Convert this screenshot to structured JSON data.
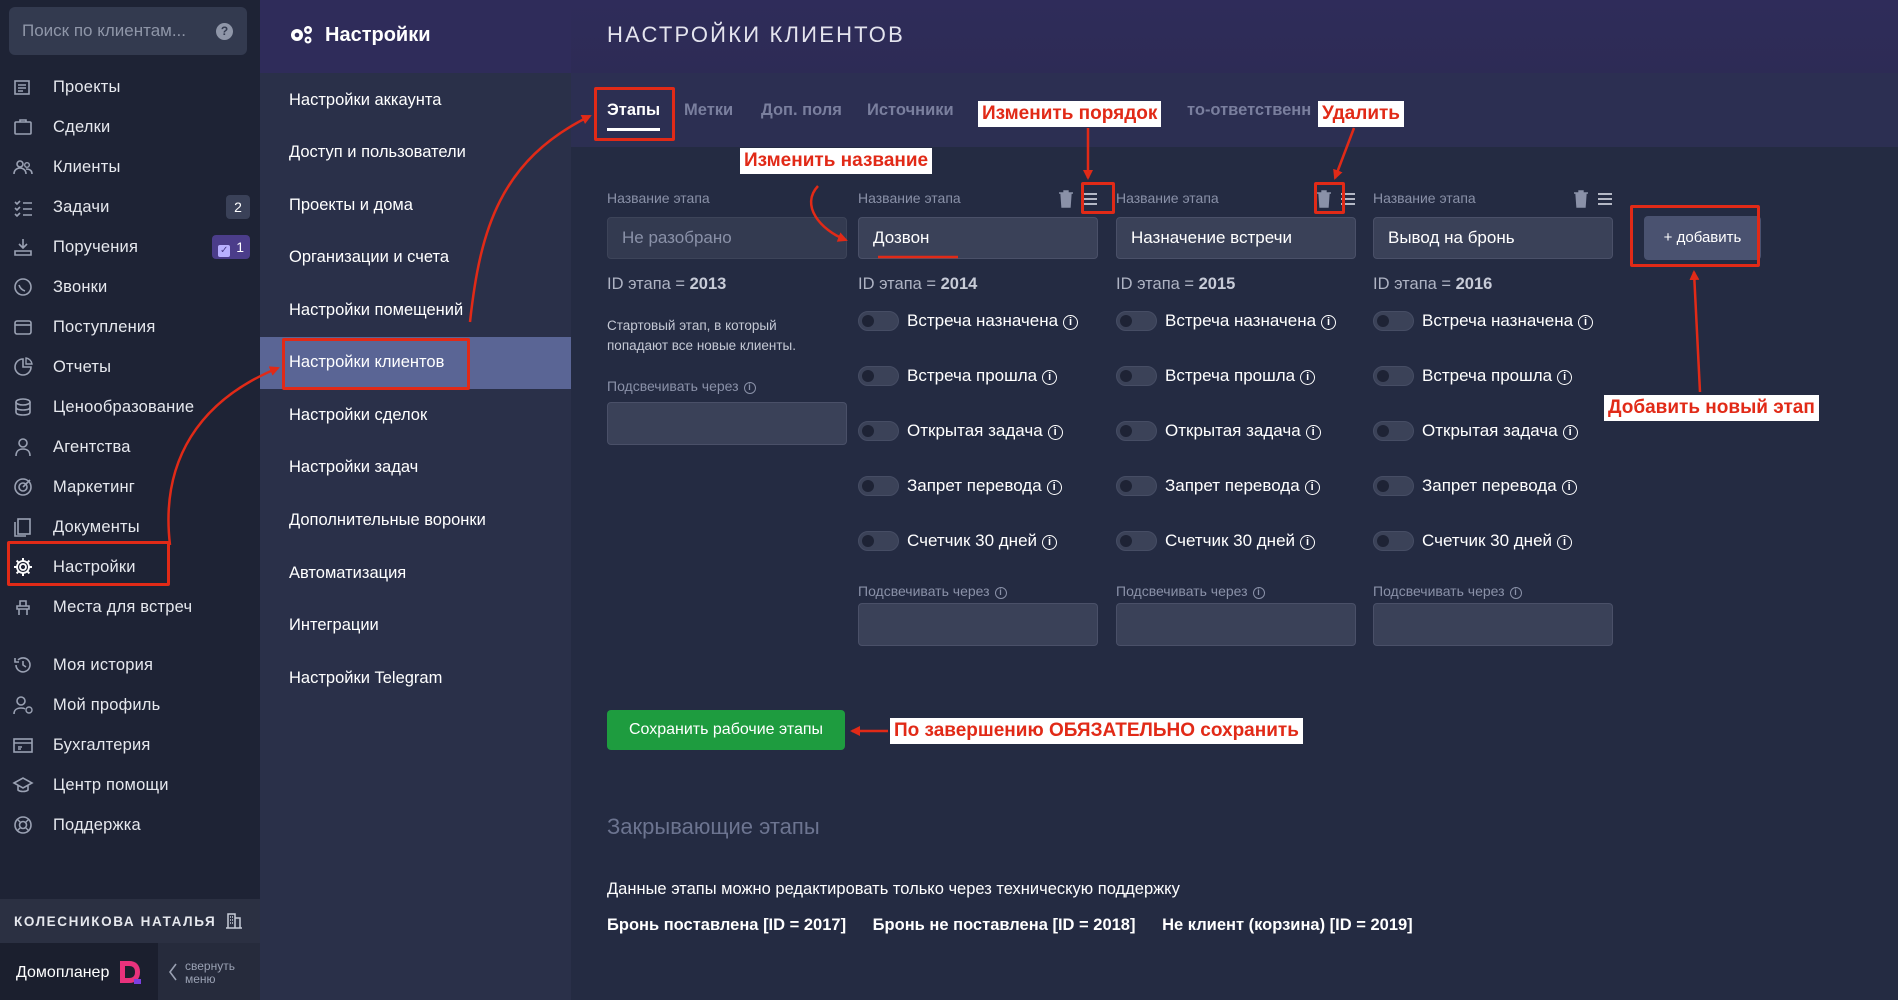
{
  "search": {
    "placeholder": "Поиск по клиентам...",
    "help": "?"
  },
  "nav": {
    "items": [
      {
        "label": "Проекты",
        "icon": "projects-icon"
      },
      {
        "label": "Сделки",
        "icon": "deals-icon"
      },
      {
        "label": "Клиенты",
        "icon": "clients-icon"
      },
      {
        "label": "Задачи",
        "icon": "tasks-icon",
        "badge": "2"
      },
      {
        "label": "Поручения",
        "icon": "assignments-icon",
        "badge": "1"
      },
      {
        "label": "Звонки",
        "icon": "calls-icon"
      },
      {
        "label": "Поступления",
        "icon": "receipts-icon"
      },
      {
        "label": "Отчеты",
        "icon": "reports-icon"
      },
      {
        "label": "Ценообразование",
        "icon": "pricing-icon"
      },
      {
        "label": "Агентства",
        "icon": "agencies-icon"
      },
      {
        "label": "Маркетинг",
        "icon": "marketing-icon"
      },
      {
        "label": "Документы",
        "icon": "documents-icon"
      },
      {
        "label": "Настройки",
        "icon": "gear-icon"
      },
      {
        "label": "Места для встреч",
        "icon": "meeting-places-icon"
      },
      {
        "label": "Моя история",
        "icon": "history-icon"
      },
      {
        "label": "Мой профиль",
        "icon": "profile-icon"
      },
      {
        "label": "Бухгалтерия",
        "icon": "accounting-icon"
      },
      {
        "label": "Центр помощи",
        "icon": "help-center-icon"
      },
      {
        "label": "Поддержка",
        "icon": "support-icon"
      }
    ],
    "user_name": "КОЛЕСНИКОВА НАТАЛЬЯ",
    "brand": "Домопланер",
    "collapse_line1": "свернуть",
    "collapse_line2": "меню"
  },
  "subnav": {
    "title": "Настройки",
    "items": [
      "Настройки аккаунта",
      "Доступ и пользователи",
      "Проекты и дома",
      "Организации и счета",
      "Настройки помещений",
      "Настройки клиентов",
      "Настройки сделок",
      "Настройки задач",
      "Дополнительные воронки",
      "Автоматизация",
      "Интеграции",
      "Настройки Telegram"
    ],
    "active_index": 5
  },
  "main": {
    "title": "НАСТРОЙКИ КЛИЕНТОВ",
    "tabs": [
      "Этапы",
      "Метки",
      "Доп. поля",
      "Источники",
      "то-ответственн"
    ],
    "stage_label": "Название этапа",
    "stages": [
      {
        "name": "Не разобрано",
        "id_prefix": "ID этапа = ",
        "id": "2013",
        "description": "Стартовый этап, в который попадают все новые клиенты."
      },
      {
        "name": "Дозвон",
        "id_prefix": "ID этапа = ",
        "id": "2014"
      },
      {
        "name": "Назначение встречи",
        "id_prefix": "ID этапа = ",
        "id": "2015"
      },
      {
        "name": "Вывод на бронь",
        "id_prefix": "ID этапа = ",
        "id": "2016"
      }
    ],
    "toggles": [
      "Встреча назначена",
      "Встреча прошла",
      "Открытая задача",
      "Запрет перевода",
      "Счетчик 30 дней"
    ],
    "highlight_label": "Подсвечивать через",
    "add_button": "+ добавить",
    "save_button": "Сохранить рабочие этапы",
    "closing_title": "Закрывающие этапы",
    "closing_note": "Данные этапы можно редактировать только через техническую поддержку",
    "closing_stages": [
      "Бронь поставлена [ID = 2017]",
      "Бронь не поставлена [ID = 2018]",
      "Не клиент (корзина) [ID = 2019]"
    ]
  },
  "annotations": {
    "rename": "Изменить название",
    "reorder": "Изменить порядок",
    "delete": "Удалить",
    "add_stage": "Добавить новый этап",
    "must_save": "По завершению ОБЯЗАТЕЛЬНО сохранить"
  },
  "colors": {
    "annotation": "#e12a17",
    "save": "#1e9c3f",
    "active_subnav": "#5a6595"
  }
}
